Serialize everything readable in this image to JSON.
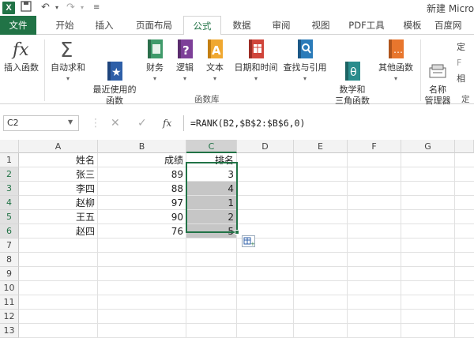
{
  "app": {
    "logo_letter": "X",
    "title": "新建 Micro"
  },
  "quick_access": {
    "save_icon": "save-icon",
    "undo": "↶",
    "redo": "↷"
  },
  "tabs": [
    "文件",
    "开始",
    "插入",
    "页面布局",
    "公式",
    "数据",
    "审阅",
    "视图",
    "PDF工具",
    "模板",
    "百度网"
  ],
  "active_tab": "公式",
  "ribbon": {
    "buttons": [
      {
        "label": "插入函数",
        "icon": "fx-icon"
      },
      {
        "label": "自动求和",
        "icon": "sigma-icon"
      },
      {
        "label": "最近使用的\n函数",
        "icon": "star-book-icon"
      },
      {
        "label": "财务",
        "icon": "finance-book-icon"
      },
      {
        "label": "逻辑",
        "icon": "logic-book-icon"
      },
      {
        "label": "文本",
        "icon": "text-book-icon"
      },
      {
        "label": "日期和时间",
        "icon": "calendar-book-icon"
      },
      {
        "label": "查找与引用",
        "icon": "lookup-book-icon"
      },
      {
        "label": "数学和\n三角函数",
        "icon": "math-book-icon"
      },
      {
        "label": "其他函数",
        "icon": "more-book-icon"
      },
      {
        "label": "名称\n管理器",
        "icon": "name-manager-icon"
      }
    ],
    "group_label": "函数库",
    "partial_right_label": "定",
    "partial_right_items": [
      "定",
      "F",
      "相"
    ]
  },
  "formula_bar": {
    "name_box": "C2",
    "fx": "fx",
    "formula": "=RANK(B2,$B$2:$B$6,0)"
  },
  "columns": [
    "A",
    "B",
    "C",
    "D",
    "E",
    "F",
    "G"
  ],
  "rows": [
    "1",
    "2",
    "3",
    "4",
    "5",
    "6",
    "7",
    "8",
    "9",
    "10",
    "11",
    "12",
    "13"
  ],
  "cells": {
    "A1": "姓名",
    "B1": "成绩",
    "C1": "排名",
    "A2": "张三",
    "B2": "89",
    "C2": "3",
    "A3": "李四",
    "B3": "88",
    "C3": "4",
    "A4": "赵柳",
    "B4": "97",
    "C4": "1",
    "A5": "王五",
    "B5": "90",
    "C5": "2",
    "A6": "赵四",
    "B6": "76",
    "C6": "5"
  },
  "colors": {
    "excel_green": "#217346",
    "selection_gray": "#c6c6c6"
  }
}
